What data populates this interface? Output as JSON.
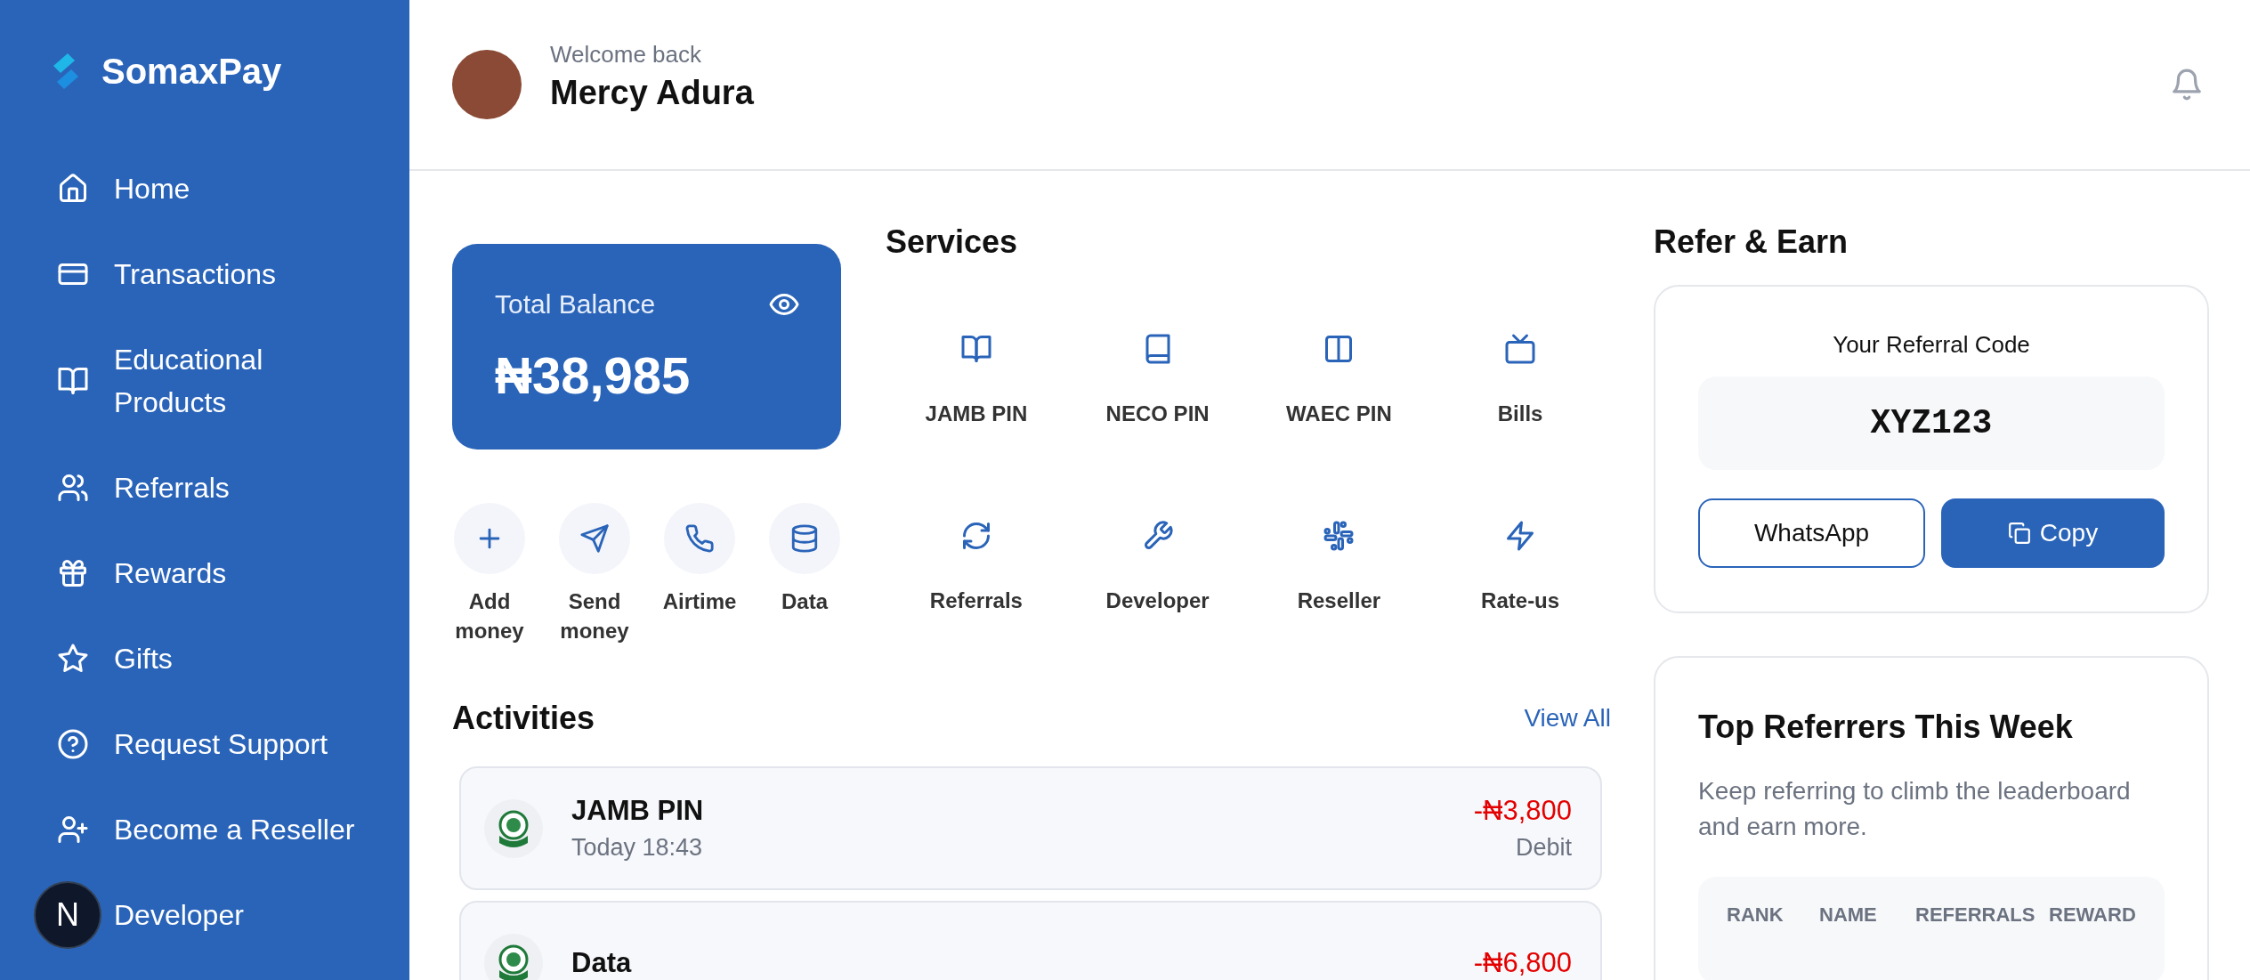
{
  "sidebar": {
    "brand": "SomaxPay",
    "dev_badge": "N",
    "items": [
      {
        "label": "Home"
      },
      {
        "label": "Transactions"
      },
      {
        "label": "Educational Products"
      },
      {
        "label": "Referrals"
      },
      {
        "label": "Rewards"
      },
      {
        "label": "Gifts"
      },
      {
        "label": "Request Support"
      },
      {
        "label": "Become a Reseller"
      },
      {
        "label": "Developer"
      }
    ]
  },
  "header": {
    "greeting": "Welcome back",
    "name": "Mercy Adura"
  },
  "balance": {
    "label": "Total Balance",
    "amount": "₦38,985"
  },
  "quick_actions": [
    {
      "label": "Add money"
    },
    {
      "label": "Send money"
    },
    {
      "label": "Airtime"
    },
    {
      "label": "Data"
    }
  ],
  "services": {
    "title": "Services",
    "items": [
      {
        "label": "JAMB PIN"
      },
      {
        "label": "NECO PIN"
      },
      {
        "label": "WAEC PIN"
      },
      {
        "label": "Bills"
      },
      {
        "label": "Referrals"
      },
      {
        "label": "Developer"
      },
      {
        "label": "Reseller"
      },
      {
        "label": "Rate-us"
      }
    ]
  },
  "activities": {
    "title": "Activities",
    "view_all": "View All",
    "items": [
      {
        "title": "JAMB PIN",
        "time": "Today 18:43",
        "amount": "-₦3,800",
        "type": "Debit"
      },
      {
        "title": "Data",
        "amount": "-₦6,800"
      }
    ]
  },
  "refer": {
    "title": "Refer & Earn",
    "code_label": "Your Referral Code",
    "code": "XYZ123",
    "whatsapp": "WhatsApp",
    "copy": "Copy"
  },
  "leaderboard": {
    "title": "Top Referrers This Week",
    "description": "Keep referring to climb the leaderboard and earn more.",
    "columns": [
      "RANK",
      "NAME",
      "REFERRALS",
      "REWARD"
    ]
  }
}
